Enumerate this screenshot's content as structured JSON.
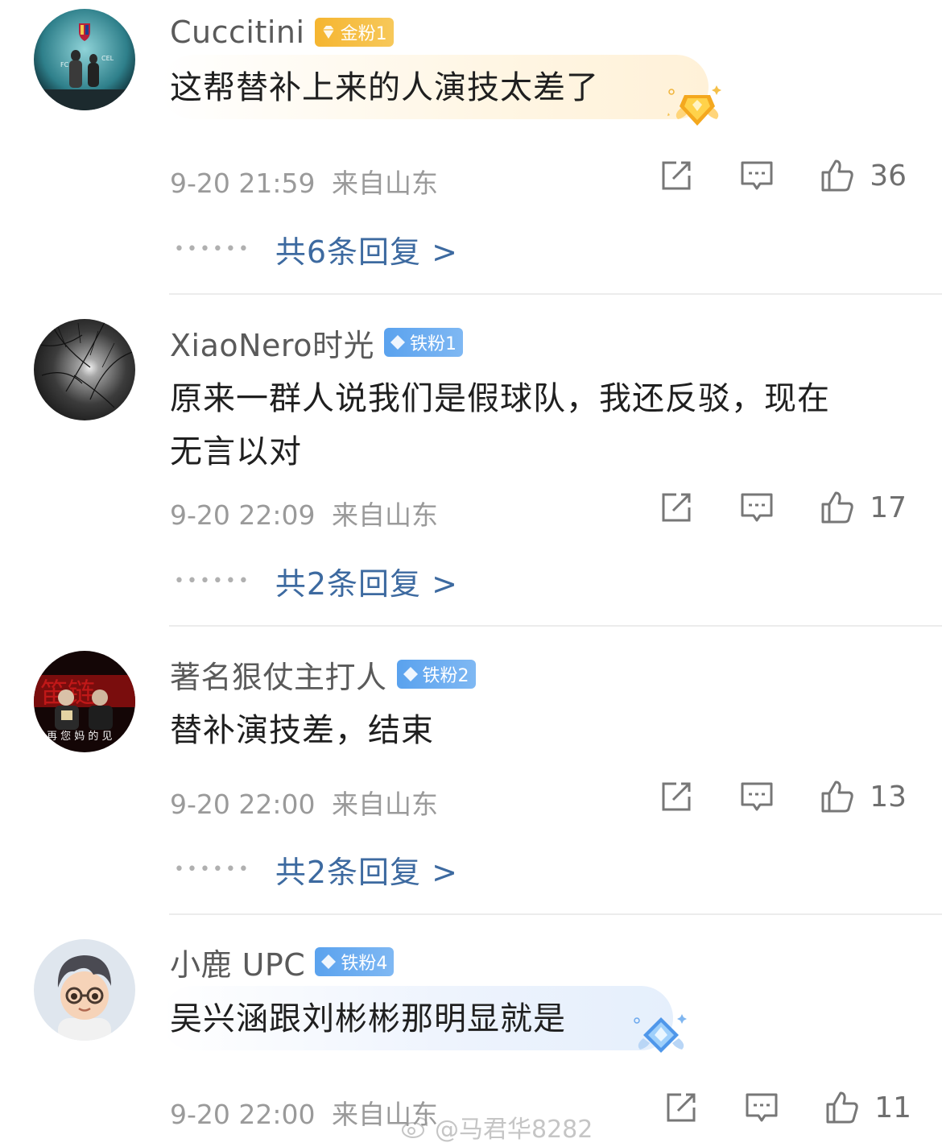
{
  "comments": [
    {
      "username": "Cuccitini",
      "badge": "金粉1",
      "badge_color": "#f5b530",
      "text_lines": [
        "这帮替补上来的人演技太差了"
      ],
      "time": "9-20 21:59",
      "location": "来自山东",
      "likes": "36",
      "replies": "共6条回复 >",
      "avatar_icon": "fc-barcelona-photo-avatar"
    },
    {
      "username": "XiaoNero时光",
      "badge": "铁粉1",
      "badge_color": "#5aa2ee",
      "text_lines": [
        "原来一群人说我们是假球队，我还反驳，现在",
        "无言以对"
      ],
      "time": "9-20 22:09",
      "location": "来自山东",
      "likes": "17",
      "replies": "共2条回复 >",
      "avatar_icon": "night-moon-branches-avatar"
    },
    {
      "username": "著名狠仗主打人",
      "badge": "铁粉2",
      "badge_color": "#5aa2ee",
      "text_lines": [
        "替补演技差，结束"
      ],
      "time": "9-20 22:00",
      "location": "来自山东",
      "likes": "13",
      "replies": "共2条回复 >",
      "avatar_icon": "two-men-red-poster-avatar"
    },
    {
      "username": "小鹿 UPC",
      "badge": "铁粉4",
      "badge_color": "#5aa2ee",
      "text_lines": [
        "吴兴涵跟刘彬彬那明显就是"
      ],
      "time": "9-20 22:00",
      "location": "来自山东",
      "likes": "11",
      "avatar_icon": "cartoon-boy-glasses-avatar"
    }
  ],
  "watermark": "@马君华8282",
  "colors": {
    "reply_link": "#3d6aa0",
    "meta_text": "#9a9a9a",
    "gold_badge": "#f5b530",
    "iron_badge": "#5aa2ee"
  }
}
